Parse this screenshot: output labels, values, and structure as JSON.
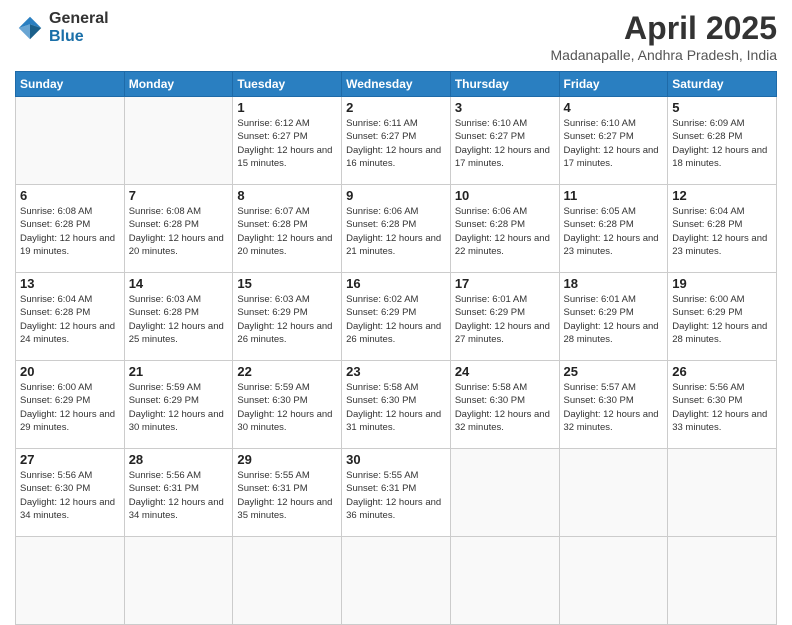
{
  "logo": {
    "general": "General",
    "blue": "Blue"
  },
  "title": "April 2025",
  "location": "Madanapalle, Andhra Pradesh, India",
  "weekdays": [
    "Sunday",
    "Monday",
    "Tuesday",
    "Wednesday",
    "Thursday",
    "Friday",
    "Saturday"
  ],
  "days": [
    {
      "num": "",
      "sunrise": "",
      "sunset": "",
      "daylight": ""
    },
    {
      "num": "",
      "sunrise": "",
      "sunset": "",
      "daylight": ""
    },
    {
      "num": "1",
      "sunrise": "Sunrise: 6:12 AM",
      "sunset": "Sunset: 6:27 PM",
      "daylight": "Daylight: 12 hours and 15 minutes."
    },
    {
      "num": "2",
      "sunrise": "Sunrise: 6:11 AM",
      "sunset": "Sunset: 6:27 PM",
      "daylight": "Daylight: 12 hours and 16 minutes."
    },
    {
      "num": "3",
      "sunrise": "Sunrise: 6:10 AM",
      "sunset": "Sunset: 6:27 PM",
      "daylight": "Daylight: 12 hours and 17 minutes."
    },
    {
      "num": "4",
      "sunrise": "Sunrise: 6:10 AM",
      "sunset": "Sunset: 6:27 PM",
      "daylight": "Daylight: 12 hours and 17 minutes."
    },
    {
      "num": "5",
      "sunrise": "Sunrise: 6:09 AM",
      "sunset": "Sunset: 6:28 PM",
      "daylight": "Daylight: 12 hours and 18 minutes."
    },
    {
      "num": "6",
      "sunrise": "Sunrise: 6:08 AM",
      "sunset": "Sunset: 6:28 PM",
      "daylight": "Daylight: 12 hours and 19 minutes."
    },
    {
      "num": "7",
      "sunrise": "Sunrise: 6:08 AM",
      "sunset": "Sunset: 6:28 PM",
      "daylight": "Daylight: 12 hours and 20 minutes."
    },
    {
      "num": "8",
      "sunrise": "Sunrise: 6:07 AM",
      "sunset": "Sunset: 6:28 PM",
      "daylight": "Daylight: 12 hours and 20 minutes."
    },
    {
      "num": "9",
      "sunrise": "Sunrise: 6:06 AM",
      "sunset": "Sunset: 6:28 PM",
      "daylight": "Daylight: 12 hours and 21 minutes."
    },
    {
      "num": "10",
      "sunrise": "Sunrise: 6:06 AM",
      "sunset": "Sunset: 6:28 PM",
      "daylight": "Daylight: 12 hours and 22 minutes."
    },
    {
      "num": "11",
      "sunrise": "Sunrise: 6:05 AM",
      "sunset": "Sunset: 6:28 PM",
      "daylight": "Daylight: 12 hours and 23 minutes."
    },
    {
      "num": "12",
      "sunrise": "Sunrise: 6:04 AM",
      "sunset": "Sunset: 6:28 PM",
      "daylight": "Daylight: 12 hours and 23 minutes."
    },
    {
      "num": "13",
      "sunrise": "Sunrise: 6:04 AM",
      "sunset": "Sunset: 6:28 PM",
      "daylight": "Daylight: 12 hours and 24 minutes."
    },
    {
      "num": "14",
      "sunrise": "Sunrise: 6:03 AM",
      "sunset": "Sunset: 6:28 PM",
      "daylight": "Daylight: 12 hours and 25 minutes."
    },
    {
      "num": "15",
      "sunrise": "Sunrise: 6:03 AM",
      "sunset": "Sunset: 6:29 PM",
      "daylight": "Daylight: 12 hours and 26 minutes."
    },
    {
      "num": "16",
      "sunrise": "Sunrise: 6:02 AM",
      "sunset": "Sunset: 6:29 PM",
      "daylight": "Daylight: 12 hours and 26 minutes."
    },
    {
      "num": "17",
      "sunrise": "Sunrise: 6:01 AM",
      "sunset": "Sunset: 6:29 PM",
      "daylight": "Daylight: 12 hours and 27 minutes."
    },
    {
      "num": "18",
      "sunrise": "Sunrise: 6:01 AM",
      "sunset": "Sunset: 6:29 PM",
      "daylight": "Daylight: 12 hours and 28 minutes."
    },
    {
      "num": "19",
      "sunrise": "Sunrise: 6:00 AM",
      "sunset": "Sunset: 6:29 PM",
      "daylight": "Daylight: 12 hours and 28 minutes."
    },
    {
      "num": "20",
      "sunrise": "Sunrise: 6:00 AM",
      "sunset": "Sunset: 6:29 PM",
      "daylight": "Daylight: 12 hours and 29 minutes."
    },
    {
      "num": "21",
      "sunrise": "Sunrise: 5:59 AM",
      "sunset": "Sunset: 6:29 PM",
      "daylight": "Daylight: 12 hours and 30 minutes."
    },
    {
      "num": "22",
      "sunrise": "Sunrise: 5:59 AM",
      "sunset": "Sunset: 6:30 PM",
      "daylight": "Daylight: 12 hours and 30 minutes."
    },
    {
      "num": "23",
      "sunrise": "Sunrise: 5:58 AM",
      "sunset": "Sunset: 6:30 PM",
      "daylight": "Daylight: 12 hours and 31 minutes."
    },
    {
      "num": "24",
      "sunrise": "Sunrise: 5:58 AM",
      "sunset": "Sunset: 6:30 PM",
      "daylight": "Daylight: 12 hours and 32 minutes."
    },
    {
      "num": "25",
      "sunrise": "Sunrise: 5:57 AM",
      "sunset": "Sunset: 6:30 PM",
      "daylight": "Daylight: 12 hours and 32 minutes."
    },
    {
      "num": "26",
      "sunrise": "Sunrise: 5:56 AM",
      "sunset": "Sunset: 6:30 PM",
      "daylight": "Daylight: 12 hours and 33 minutes."
    },
    {
      "num": "27",
      "sunrise": "Sunrise: 5:56 AM",
      "sunset": "Sunset: 6:30 PM",
      "daylight": "Daylight: 12 hours and 34 minutes."
    },
    {
      "num": "28",
      "sunrise": "Sunrise: 5:56 AM",
      "sunset": "Sunset: 6:31 PM",
      "daylight": "Daylight: 12 hours and 34 minutes."
    },
    {
      "num": "29",
      "sunrise": "Sunrise: 5:55 AM",
      "sunset": "Sunset: 6:31 PM",
      "daylight": "Daylight: 12 hours and 35 minutes."
    },
    {
      "num": "30",
      "sunrise": "Sunrise: 5:55 AM",
      "sunset": "Sunset: 6:31 PM",
      "daylight": "Daylight: 12 hours and 36 minutes."
    },
    {
      "num": "",
      "sunrise": "",
      "sunset": "",
      "daylight": ""
    },
    {
      "num": "",
      "sunrise": "",
      "sunset": "",
      "daylight": ""
    },
    {
      "num": "",
      "sunrise": "",
      "sunset": "",
      "daylight": ""
    },
    {
      "num": "",
      "sunrise": "",
      "sunset": "",
      "daylight": ""
    },
    {
      "num": "",
      "sunrise": "",
      "sunset": "",
      "daylight": ""
    }
  ]
}
